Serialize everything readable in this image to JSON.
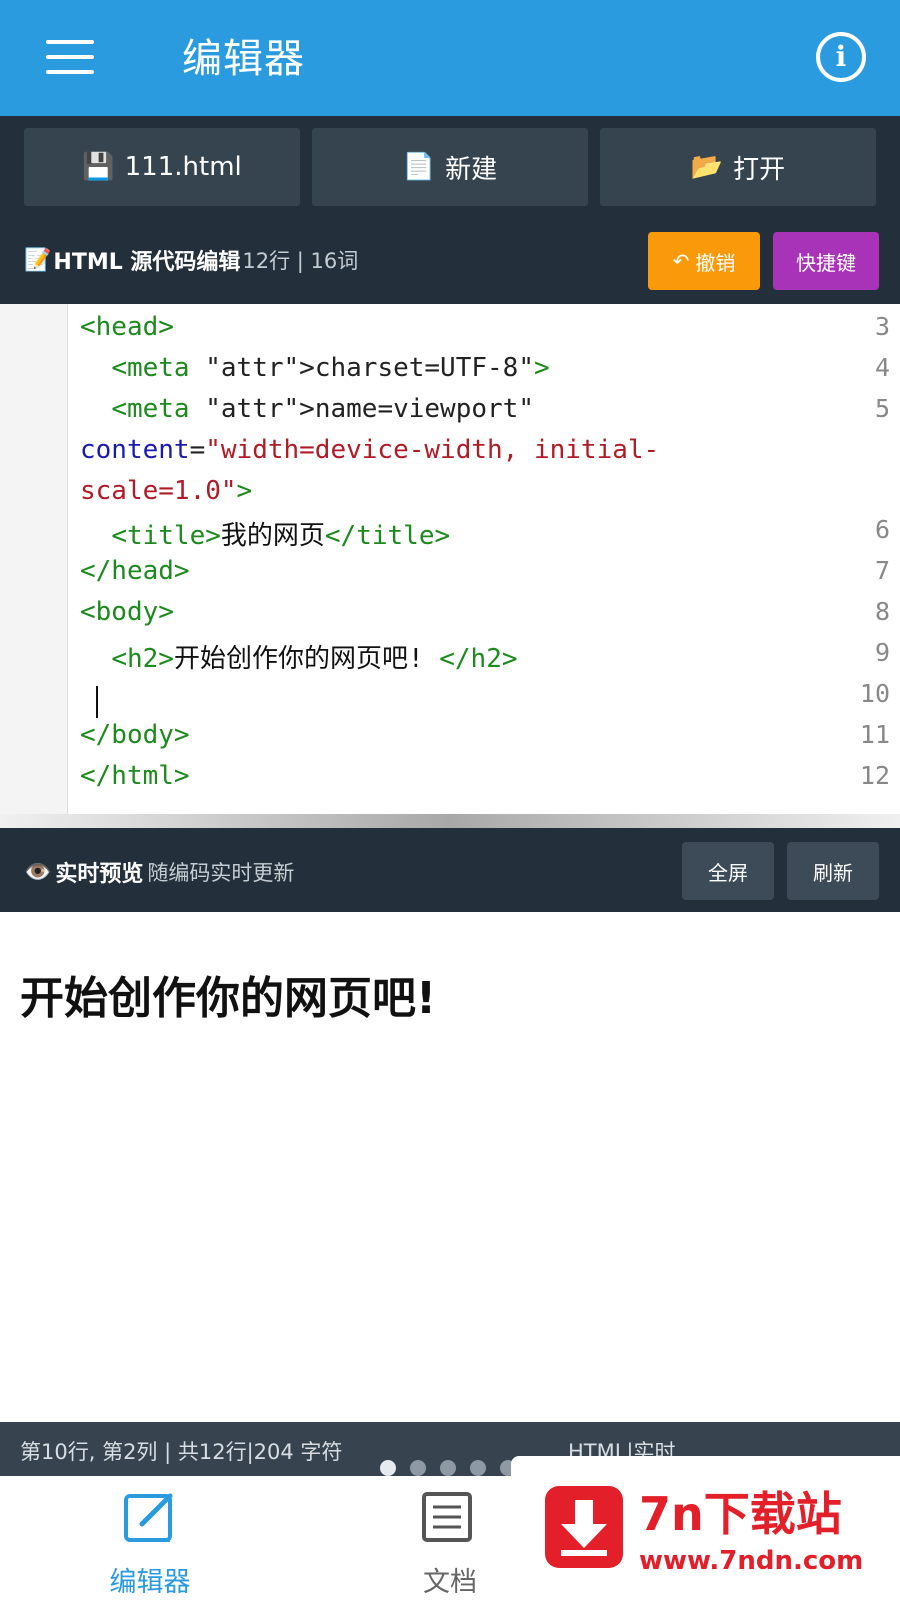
{
  "appbar": {
    "title": "编辑器"
  },
  "toolbar": {
    "file_label": "111.html",
    "new_label": "新建",
    "open_label": "打开"
  },
  "code_header": {
    "title": "HTML 源代码编辑",
    "stats": "12行 | 16词",
    "undo_label": "撤销",
    "shortcuts_label": "快捷键"
  },
  "editor": {
    "lines": [
      {
        "num": "3",
        "text": "<head>"
      },
      {
        "num": "4",
        "text": "  <meta charset=\"UTF-8\">"
      },
      {
        "num": "5",
        "text": "  <meta name=\"viewport\""
      },
      {
        "num": "",
        "text": "content=\"width=device-width, initial-"
      },
      {
        "num": "",
        "text": "scale=1.0\">"
      },
      {
        "num": "6",
        "text": "  <title>我的网页</title>"
      },
      {
        "num": "7",
        "text": "</head>"
      },
      {
        "num": "8",
        "text": "<body>"
      },
      {
        "num": "9",
        "text": "  <h2>开始创作你的网页吧! </h2>"
      },
      {
        "num": "10",
        "text": ""
      },
      {
        "num": "11",
        "text": "</body>"
      },
      {
        "num": "12",
        "text": "</html>"
      }
    ]
  },
  "preview_header": {
    "title": "实时预览",
    "subtitle": "随编码实时更新",
    "fullscreen_label": "全屏",
    "refresh_label": "刷新"
  },
  "preview": {
    "heading": "开始创作你的网页吧!"
  },
  "statusbar": {
    "left": "第10行, 第2列 | 共12行|204 字符",
    "right": "HTML|实时"
  },
  "bottomnav": {
    "items": [
      {
        "label": "编辑器",
        "icon": "edit-icon",
        "active": true
      },
      {
        "label": "文档",
        "icon": "document-icon",
        "active": false
      }
    ]
  },
  "watermark": {
    "brand": "7n下载站",
    "url": "www.7ndn.com"
  },
  "colors": {
    "primary": "#2b9be0",
    "dark": "#232f3a",
    "undo": "#fa9a0a",
    "shortcuts": "#a832b8"
  }
}
